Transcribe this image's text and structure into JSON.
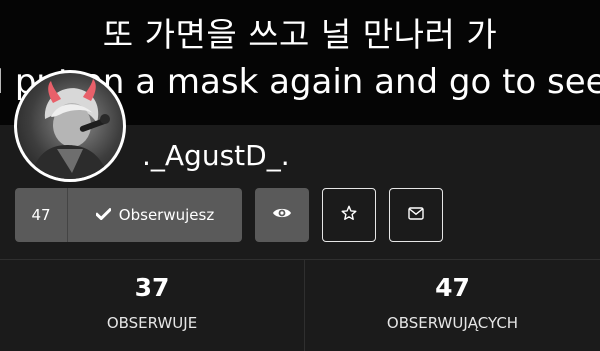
{
  "banner": {
    "line1": "또 가면을 쓰고 널 만나러 가",
    "line2": "I put on a mask again and go to see you"
  },
  "profile": {
    "username": "._AgustD_."
  },
  "actions": {
    "follower_count": "47",
    "follow_label": "Obserwujesz",
    "follow_icon": "check-icon",
    "watch_icon": "eye-icon",
    "favorite_icon": "star-icon",
    "message_icon": "envelope-icon"
  },
  "stats": {
    "following": {
      "value": "37",
      "label": "OBSERWUJE"
    },
    "followers": {
      "value": "47",
      "label": "OBSERWUJĄCYCH"
    }
  },
  "colors": {
    "background": "#1b1b1b",
    "banner": "#050505",
    "button_fill": "#5a5a5a",
    "text": "#ffffff",
    "devil_horns": "#e8606a"
  }
}
